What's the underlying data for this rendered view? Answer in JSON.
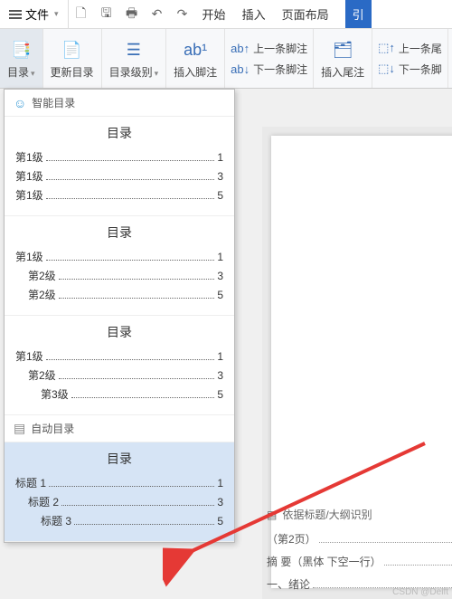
{
  "top": {
    "file_label": "文件",
    "tabs": [
      "开始",
      "插入",
      "页面布局",
      "引"
    ]
  },
  "ribbon": {
    "toc": "目录",
    "update": "更新目录",
    "level": "目录级别",
    "insert_footnote": "插入脚注",
    "prev_footnote": "上一条脚注",
    "next_footnote": "下一条脚注",
    "insert_endnote": "插入尾注",
    "prev_endnote": "上一条尾",
    "next_endnote": "下一条脚"
  },
  "panel": {
    "smart_header": "智能目录",
    "auto_header": "自动目录",
    "previews": [
      {
        "title": "目录",
        "rows": [
          {
            "label": "第1级",
            "indent": 0,
            "page": "1"
          },
          {
            "label": "第1级",
            "indent": 0,
            "page": "3"
          },
          {
            "label": "第1级",
            "indent": 0,
            "page": "5"
          }
        ]
      },
      {
        "title": "目录",
        "rows": [
          {
            "label": "第1级",
            "indent": 0,
            "page": "1"
          },
          {
            "label": "第2级",
            "indent": 1,
            "page": "3"
          },
          {
            "label": "第2级",
            "indent": 1,
            "page": "5"
          }
        ]
      },
      {
        "title": "目录",
        "rows": [
          {
            "label": "第1级",
            "indent": 0,
            "page": "1"
          },
          {
            "label": "第2级",
            "indent": 1,
            "page": "3"
          },
          {
            "label": "第3级",
            "indent": 2,
            "page": "5"
          }
        ]
      }
    ],
    "auto_preview": {
      "title": "目录",
      "rows": [
        {
          "label": "标题 1",
          "indent": 0,
          "page": "1"
        },
        {
          "label": "标题 2",
          "indent": 1,
          "page": "3"
        },
        {
          "label": "标题 3",
          "indent": 2,
          "page": "5"
        }
      ]
    }
  },
  "doc": {
    "header": "依据标题/大纲识别",
    "rows": [
      {
        "label": "（第2页）",
        "page": ""
      },
      {
        "label": "摘 要（黑体    下空一行）",
        "page": ""
      },
      {
        "label": "一、绪论",
        "page": ""
      }
    ]
  },
  "watermark": "CSDN @Delft"
}
